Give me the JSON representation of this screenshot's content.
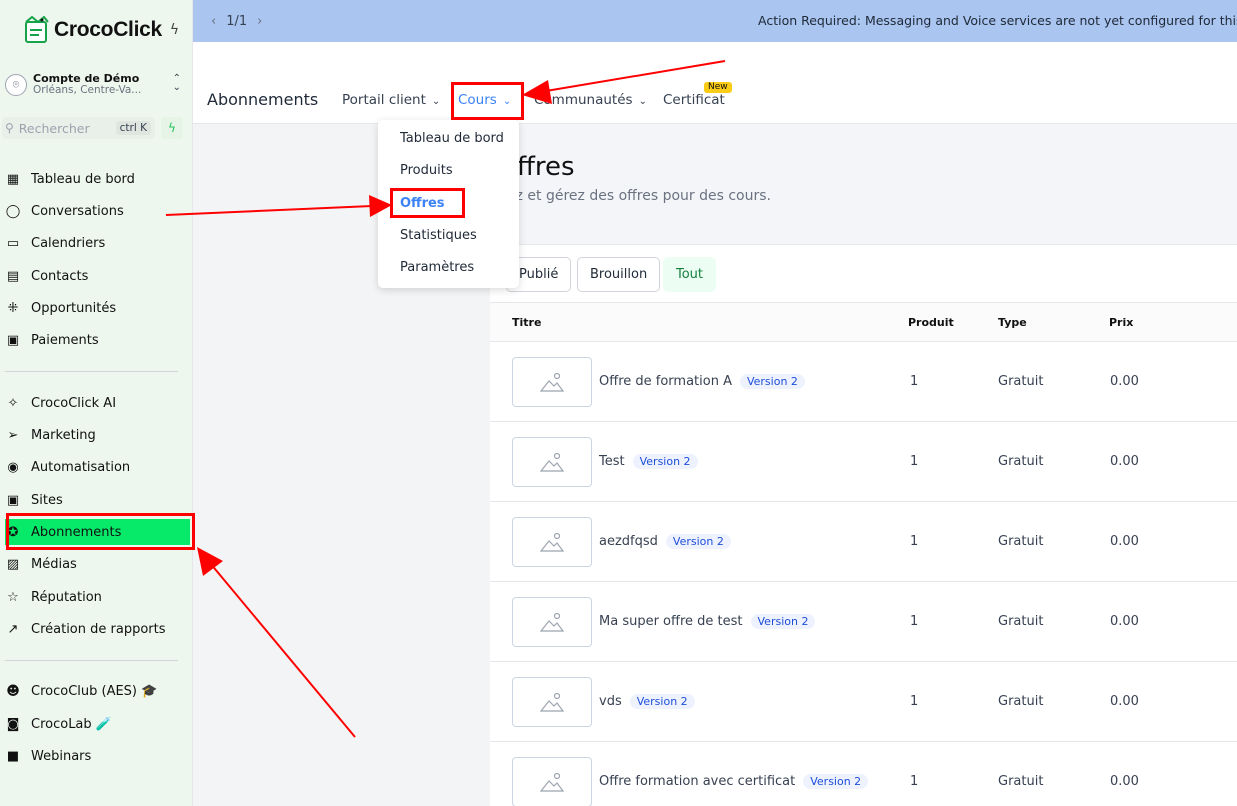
{
  "brand": {
    "name_part1": "Croco",
    "name_part2": "Click"
  },
  "account": {
    "name": "Compte de Démo",
    "location": "Orléans, Centre-Va..."
  },
  "search": {
    "placeholder": "Rechercher",
    "shortcut": "ctrl K"
  },
  "sidebar": {
    "items": [
      {
        "label": "Tableau de bord",
        "icon": "dashboard-icon"
      },
      {
        "label": "Conversations",
        "icon": "chat-icon"
      },
      {
        "label": "Calendriers",
        "icon": "calendar-icon"
      },
      {
        "label": "Contacts",
        "icon": "contacts-icon"
      },
      {
        "label": "Opportunités",
        "icon": "opportunities-icon"
      },
      {
        "label": "Paiements",
        "icon": "payments-icon"
      },
      {
        "label": "CrocoClick AI",
        "icon": "sparkle-icon"
      },
      {
        "label": "Marketing",
        "icon": "send-icon"
      },
      {
        "label": "Automatisation",
        "icon": "automation-icon"
      },
      {
        "label": "Sites",
        "icon": "sites-icon"
      },
      {
        "label": "Abonnements",
        "icon": "membership-icon"
      },
      {
        "label": "Médias",
        "icon": "media-icon"
      },
      {
        "label": "Réputation",
        "icon": "star-icon"
      },
      {
        "label": "Création de rapports",
        "icon": "reports-icon"
      },
      {
        "label": "CrocoClub (AES) 🎓",
        "icon": "users-icon"
      },
      {
        "label": "CrocoLab 🧪",
        "icon": "lab-icon"
      },
      {
        "label": "Webinars",
        "icon": "video-icon"
      }
    ]
  },
  "banner": {
    "pager": "1/1",
    "message": "Action Required: Messaging and Voice services are not yet configured for this sub"
  },
  "topnav": {
    "title": "Abonnements",
    "items": [
      {
        "label": "Portail client"
      },
      {
        "label": "Cours"
      },
      {
        "label": "Communautés"
      },
      {
        "label": "Certificat"
      }
    ],
    "new_badge": "New"
  },
  "dropdown": {
    "items": [
      "Tableau de bord",
      "Produits",
      "Offres",
      "Statistiques",
      "Paramètres"
    ]
  },
  "page": {
    "title": "Offres",
    "title_visible": "ffres",
    "subtitle": "ez et gérez des offres pour des cours."
  },
  "tabs": [
    "Publié",
    "Brouillon",
    "Tout"
  ],
  "table": {
    "headers": [
      "Titre",
      "Produit",
      "Type",
      "Prix"
    ],
    "rows": [
      {
        "title": "Offre de formation A",
        "version": "Version 2",
        "product": "1",
        "type": "Gratuit",
        "price": "0.00"
      },
      {
        "title": "Test",
        "version": "Version 2",
        "product": "1",
        "type": "Gratuit",
        "price": "0.00"
      },
      {
        "title": "aezdfqsd",
        "version": "Version 2",
        "product": "1",
        "type": "Gratuit",
        "price": "0.00"
      },
      {
        "title": "Ma super offre de test",
        "version": "Version 2",
        "product": "1",
        "type": "Gratuit",
        "price": "0.00"
      },
      {
        "title": "vds",
        "version": "Version 2",
        "product": "1",
        "type": "Gratuit",
        "price": "0.00"
      },
      {
        "title": "Offre formation avec certificat",
        "version": "Version 2",
        "product": "1",
        "type": "Gratuit",
        "price": "0.00"
      }
    ]
  },
  "colors": {
    "active_nav": "#07ea69",
    "accent": "#3b82f6",
    "annotation": "#ff0000",
    "banner": "#a9c5f0"
  }
}
